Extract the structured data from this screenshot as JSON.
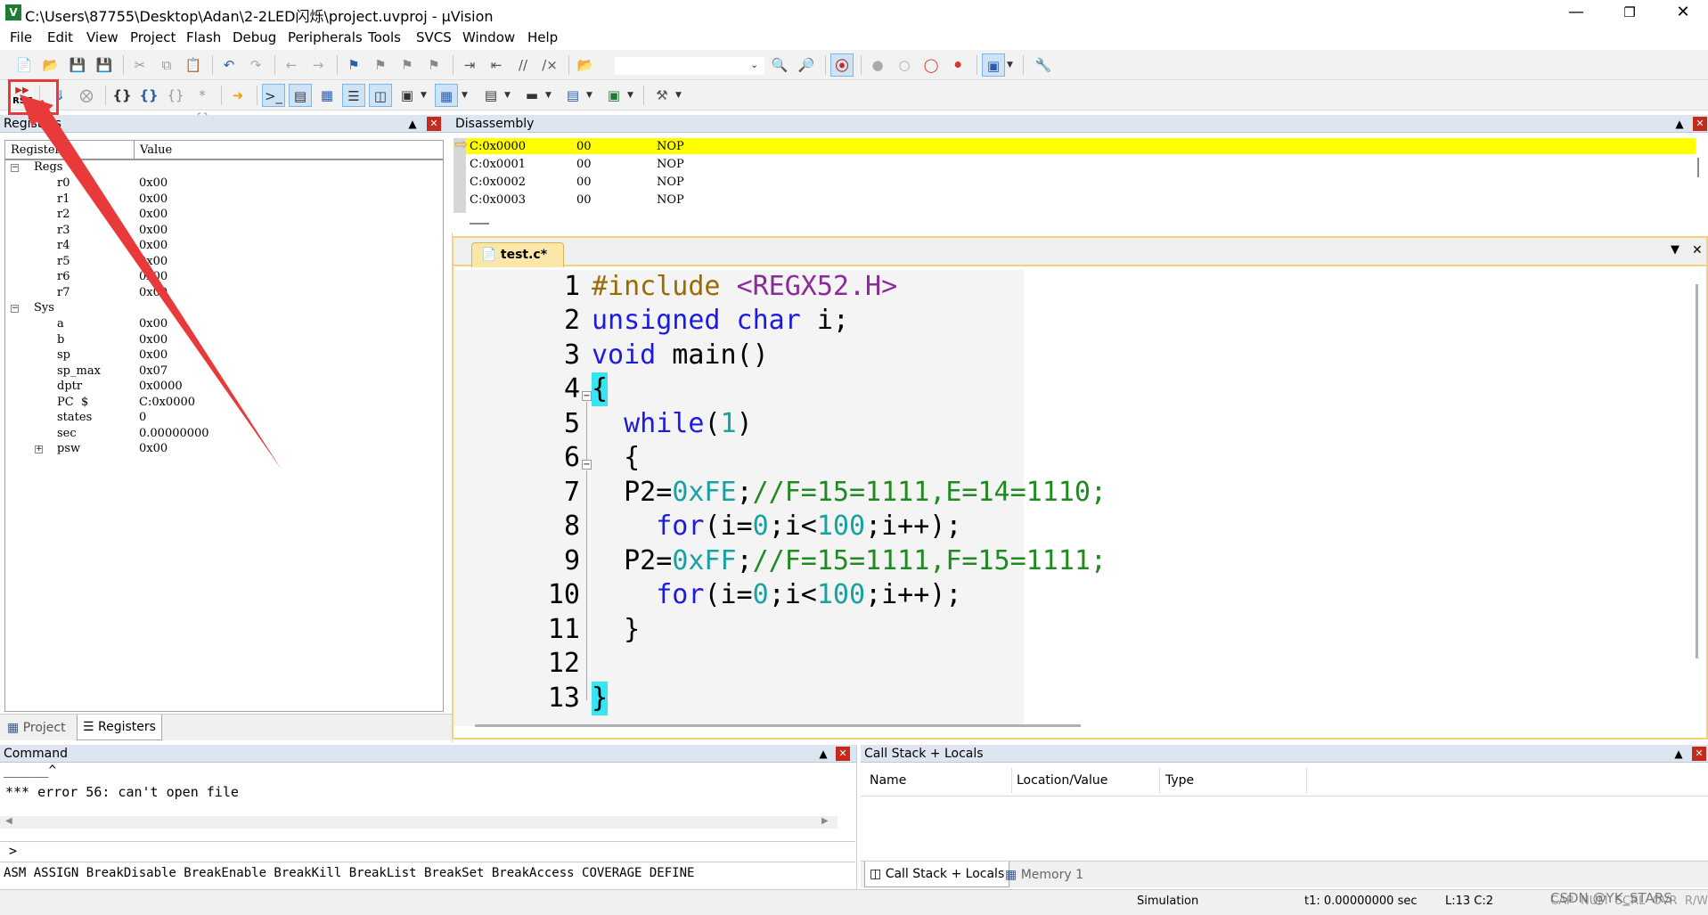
{
  "window": {
    "title": "C:\\Users\\87755\\Desktop\\Adan\\2-2LED闪烁\\project.uvproj - µVision",
    "logo": "V",
    "minimize_icon": "minimize-icon",
    "maximize_icon": "restore-icon",
    "close_icon": "close-icon"
  },
  "menu": [
    "File",
    "Edit",
    "View",
    "Project",
    "Flash",
    "Debug",
    "Peripherals",
    "Tools",
    "SVCS",
    "Window",
    "Help"
  ],
  "toolbar": {
    "rst_label": "RST"
  },
  "registers": {
    "title": "Registers",
    "col_register": "Register",
    "col_value": "Value",
    "regs_group": "Regs",
    "sys_group": "Sys",
    "regs": [
      {
        "name": "r0",
        "value": "0x00"
      },
      {
        "name": "r1",
        "value": "0x00"
      },
      {
        "name": "r2",
        "value": "0x00"
      },
      {
        "name": "r3",
        "value": "0x00"
      },
      {
        "name": "r4",
        "value": "0x00"
      },
      {
        "name": "r5",
        "value": "0x00"
      },
      {
        "name": "r6",
        "value": "0x00"
      },
      {
        "name": "r7",
        "value": "0x00"
      }
    ],
    "sys": [
      {
        "name": "a",
        "value": "0x00"
      },
      {
        "name": "b",
        "value": "0x00"
      },
      {
        "name": "sp",
        "value": "0x00"
      },
      {
        "name": "sp_max",
        "value": "0x07"
      },
      {
        "name": "dptr",
        "value": "0x0000"
      },
      {
        "name": "PC  $",
        "value": "C:0x0000"
      },
      {
        "name": "states",
        "value": "0"
      },
      {
        "name": "sec",
        "value": "0.00000000"
      },
      {
        "name": "psw",
        "value": "0x00"
      }
    ],
    "tab_project": "Project",
    "tab_registers": "Registers"
  },
  "disassembly": {
    "title": "Disassembly",
    "rows": [
      {
        "addr": "C:0x0000",
        "op": "00",
        "ins": "NOP"
      },
      {
        "addr": "C:0x0001",
        "op": "00",
        "ins": "NOP"
      },
      {
        "addr": "C:0x0002",
        "op": "00",
        "ins": "NOP"
      },
      {
        "addr": "C:0x0003",
        "op": "00",
        "ins": "NOP"
      }
    ]
  },
  "editor": {
    "tab": "test.c*",
    "line_numbers": [
      "1",
      "2",
      "3",
      "4",
      "5",
      "6",
      "7",
      "8",
      "9",
      "10",
      "11",
      "12",
      "13"
    ],
    "l1a": "#include",
    "l1b": "<REGX52.H>",
    "l2a": "unsigned char",
    "l2b": " i;",
    "l3a": "void",
    "l3b": " main()",
    "l4": "{",
    "l5a": "while",
    "l5b": "(",
    "l5c": "1",
    "l5d": ")",
    "l6": "{",
    "l7a": "P2=",
    "l7b": "0xFE",
    "l7c": ";",
    "l7d": "//F=15=1111,E=14=1110;",
    "l8a": "for",
    "l8b": "(i=",
    "l8c": "0",
    "l8d": ";i<",
    "l8e": "100",
    "l8f": ";i++);",
    "l9a": "P2=",
    "l9b": "0xFF",
    "l9c": ";",
    "l9d": "//F=15=1111,F=15=1111;",
    "l10a": "for",
    "l10b": "(i=",
    "l10c": "0",
    "l10d": ";i<",
    "l10e": "100",
    "l10f": ";i++);",
    "l11": "}",
    "l13": "}"
  },
  "command": {
    "title": "Command",
    "caret_line": "______^",
    "error": "*** error 56: can't open file",
    "prompt": ">",
    "hints": "ASM ASSIGN BreakDisable BreakEnable BreakKill BreakList BreakSet BreakAccess COVERAGE DEFINE"
  },
  "callstack": {
    "title": "Call Stack + Locals",
    "col_name": "Name",
    "col_location": "Location/Value",
    "col_type": "Type",
    "tab_callstack": "Call Stack + Locals",
    "tab_memory": "Memory 1"
  },
  "status": {
    "mode": "Simulation",
    "time": "t1: 0.00000000 sec",
    "pos": "L:13 C:2",
    "caps": "CAP  NUM  SCRL  OVR  R/W",
    "watermark": "CSDN @YK_STARS"
  },
  "annotation_color": "#e83a3a"
}
